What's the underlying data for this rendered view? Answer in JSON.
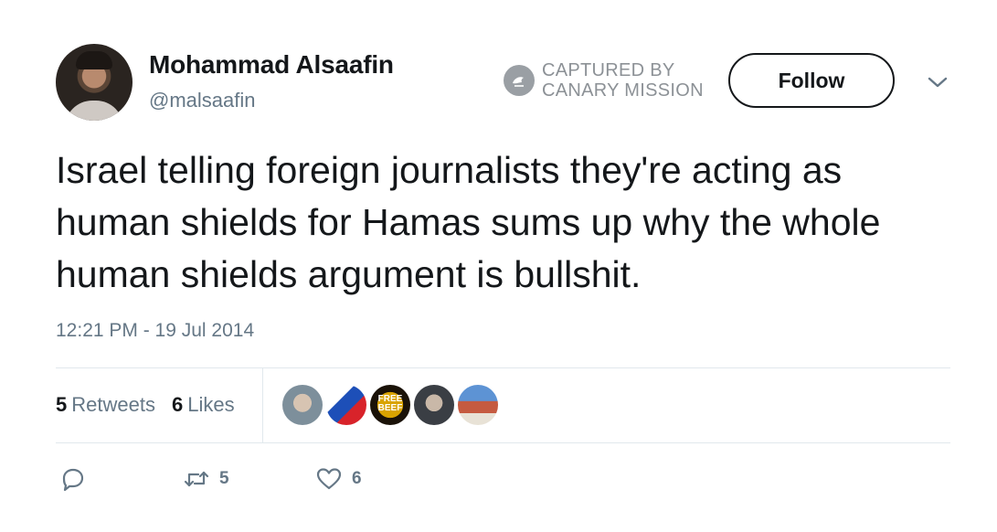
{
  "user": {
    "name": "Mohammad Alsaafin",
    "handle": "@malsaafin"
  },
  "watermark": {
    "line1": "CAPTURED BY",
    "line2": "CANARY MISSION"
  },
  "follow_label": "Follow",
  "tweet": {
    "text": "Israel telling foreign journalists they're acting as human shields for Hamas sums up why the whole human shields argument is bullshit.",
    "timestamp": "12:21 PM - 19 Jul 2014"
  },
  "stats": {
    "retweets_count": "5",
    "retweets_label": "Retweets",
    "likes_count": "6",
    "likes_label": "Likes"
  },
  "likers": [
    {
      "icon": "avatar"
    },
    {
      "icon": "avatar"
    },
    {
      "icon": "avatar",
      "text": "FREE BEEF"
    },
    {
      "icon": "avatar"
    },
    {
      "icon": "avatar"
    }
  ],
  "actions": {
    "reply_count": "",
    "retweet_count": "5",
    "like_count": "6"
  },
  "colors": {
    "text": "#14171a",
    "secondary": "#657786",
    "divider": "#e1e8ed"
  }
}
